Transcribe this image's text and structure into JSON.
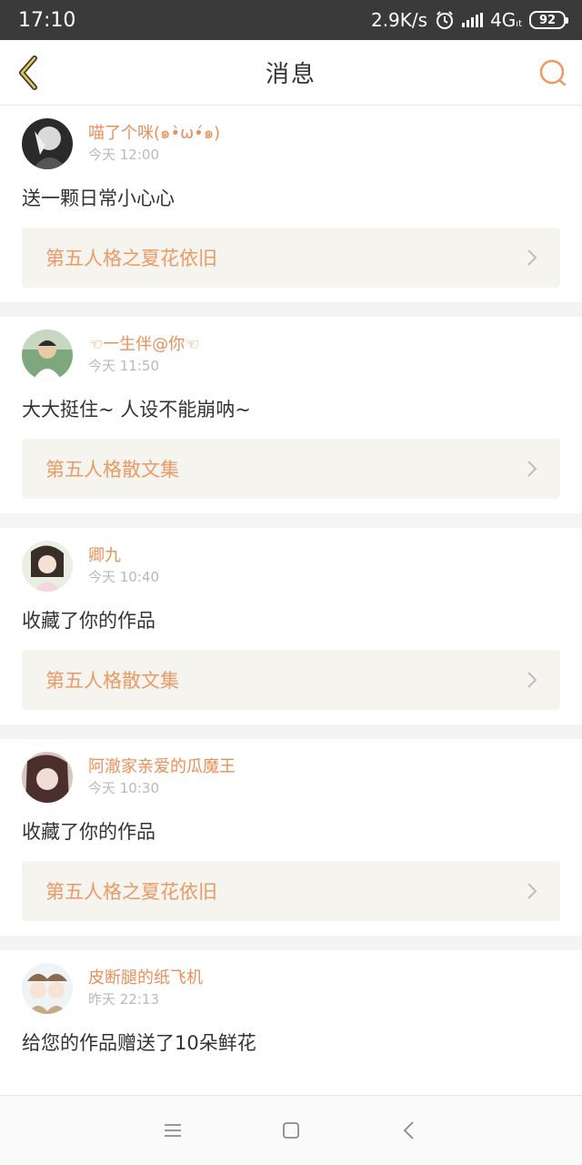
{
  "status_bar": {
    "time": "17:10",
    "net_speed": "2.9K/s",
    "network": "4G",
    "network_sub": "ıt",
    "battery": "92"
  },
  "header": {
    "title": "消息",
    "back_icon": "chevron-left-icon",
    "search_icon": "search-icon"
  },
  "messages": [
    {
      "username": "喵了个咪(๑•̀ω•́๑)",
      "time": "今天 12:00",
      "text": "送一颗日常小心心",
      "work": "第五人格之夏花依旧"
    },
    {
      "username": "☜一生伴@你☜",
      "time": "今天 11:50",
      "text": "大大挺住~ 人设不能崩呐~",
      "work": "第五人格散文集"
    },
    {
      "username": "卿九",
      "time": "今天 10:40",
      "text": "收藏了你的作品",
      "work": "第五人格散文集"
    },
    {
      "username": "阿澈家亲爱的瓜魔王",
      "time": "今天 10:30",
      "text": "收藏了你的作品",
      "work": "第五人格之夏花依旧"
    },
    {
      "username": "皮断腿的纸飞机",
      "time": "昨天 22:13",
      "text": "给您的作品赠送了10朵鲜花"
    }
  ],
  "colors": {
    "accent": "#e8905a",
    "status_bar": "#3a3a3a",
    "card_link_bg": "#f5f4ef"
  },
  "nav": {
    "menu_icon": "menu-icon",
    "home_icon": "home-square-icon",
    "back_icon": "back-triangle-icon"
  }
}
